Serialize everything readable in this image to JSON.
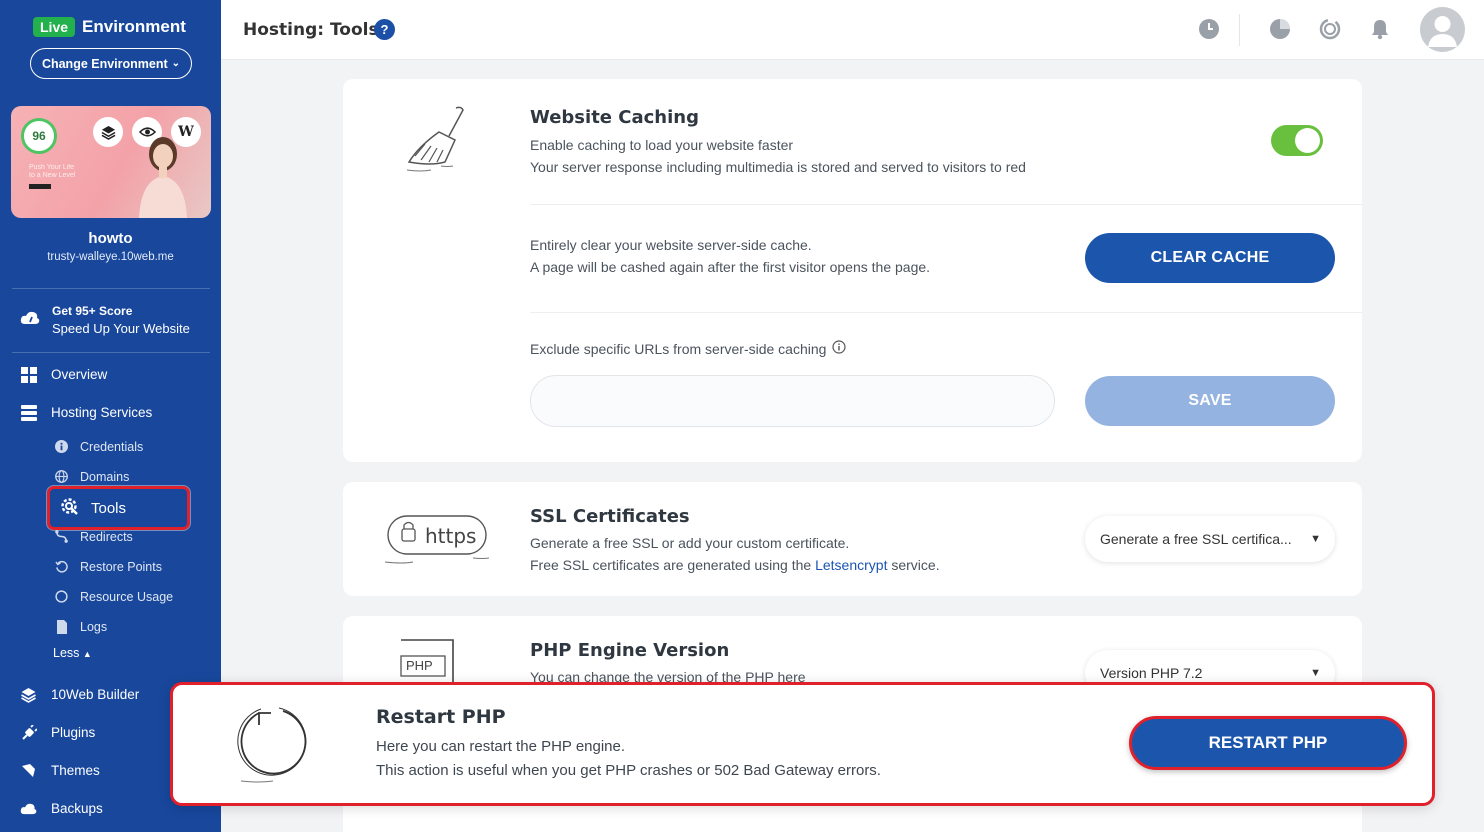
{
  "sidebar": {
    "live_badge": "Live",
    "env_title": "Environment",
    "change_env": "Change Environment",
    "score": "96",
    "thumb_text": "Push Your Life\nto a New Level",
    "site_name": "howto",
    "site_domain": "trusty-walleye.10web.me",
    "promo_line1": "Get 95+ Score",
    "promo_line2": "Speed Up Your Website",
    "nav": {
      "overview": "Overview",
      "hosting_services": "Hosting Services",
      "credentials": "Credentials",
      "domains": "Domains",
      "tools": "Tools",
      "redirects": "Redirects",
      "restore_points": "Restore Points",
      "resource_usage": "Resource Usage",
      "logs": "Logs",
      "less": "Less",
      "builder": "10Web Builder",
      "plugins": "Plugins",
      "themes": "Themes",
      "backups": "Backups"
    }
  },
  "topbar": {
    "title": "Hosting: Tools",
    "help": "?"
  },
  "caching": {
    "title": "Website Caching",
    "desc1": "Enable caching to load your website faster",
    "desc2": "Your server response including multimedia is stored and served to visitors to red",
    "toggle_on": true,
    "clear_text1": "Entirely clear your website server-side cache.",
    "clear_text2": "A page will be cashed again after the first visitor opens the page.",
    "clear_button": "CLEAR CACHE",
    "exclude_label": "Exclude specific URLs from server-side caching",
    "exclude_value": "",
    "save_button": "SAVE"
  },
  "ssl": {
    "title": "SSL Certificates",
    "desc1": "Generate a free SSL or add your custom certificate.",
    "desc2_pre": "Free SSL certificates are generated using the ",
    "desc2_link": "Letsencrypt",
    "desc2_post": " service.",
    "icon_text": "https",
    "select_value": "Generate a free SSL certifica..."
  },
  "php": {
    "title": "PHP Engine Version",
    "desc": "You can change the version of the PHP here",
    "icon_text": "PHP",
    "select_value": "Version PHP 7.2"
  },
  "restart": {
    "title": "Restart PHP",
    "desc1": "Here you can restart the PHP engine.",
    "desc2": "This action is useful when you get PHP crashes or 502 Bad Gateway errors.",
    "button": "RESTART PHP"
  },
  "colors": {
    "sidebar_bg": "#18479c",
    "primary": "#1c56ac",
    "toggle_on": "#69c03e",
    "highlight": "#e0202a"
  }
}
